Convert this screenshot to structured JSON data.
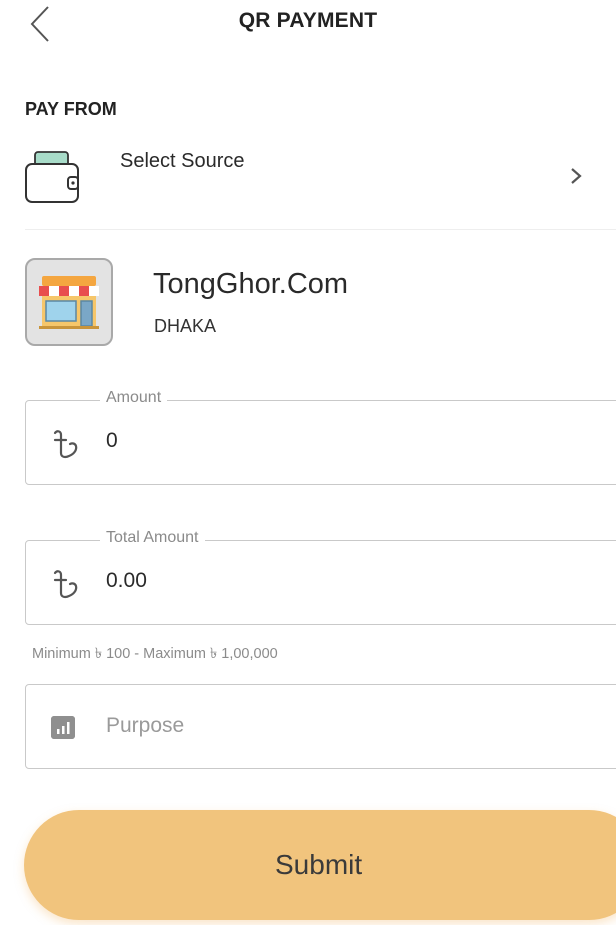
{
  "header": {
    "title": "QR PAYMENT",
    "back_icon": "chevron-left-icon"
  },
  "pay_from": {
    "label": "PAY FROM",
    "source_label": "Select Source",
    "source_icon": "wallet-icon",
    "chevron_icon": "chevron-right-icon"
  },
  "merchant": {
    "name": "TongGhor.Com",
    "city": "DHAKA",
    "logo_icon": "storefront-icon"
  },
  "amount_field": {
    "legend": "Amount",
    "currency_icon": "taka-icon",
    "value": "0"
  },
  "total_field": {
    "legend": "Total Amount",
    "currency_icon": "taka-icon",
    "value": "0.00"
  },
  "limits_hint": "Minimum ৳ 100 - Maximum ৳ 1,00,000",
  "purpose_field": {
    "placeholder": "Purpose",
    "icon": "chart-icon"
  },
  "submit": {
    "label": "Submit"
  },
  "colors": {
    "accent": "#f1c47d",
    "field_border": "#c9c9c9",
    "hint": "#8b8b8b"
  }
}
